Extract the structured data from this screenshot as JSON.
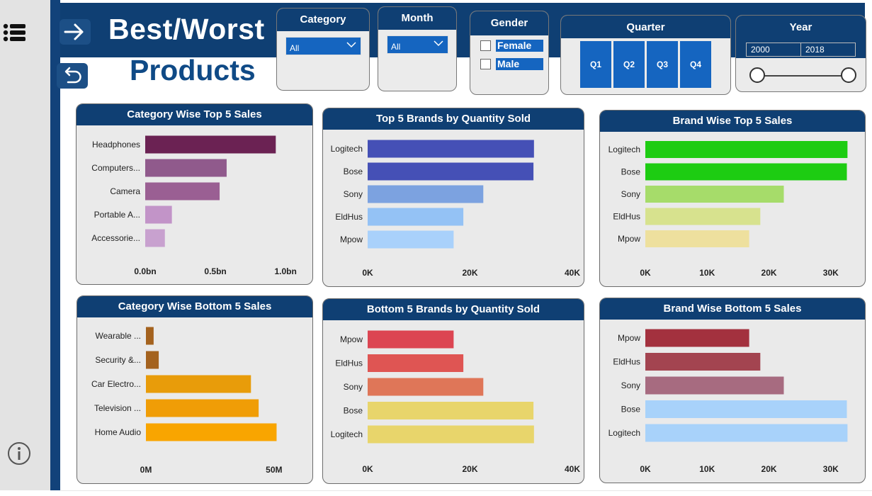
{
  "title": {
    "line1": "Best/Worst",
    "line2": "Products"
  },
  "slicers": {
    "category": {
      "label": "Category",
      "value": "All"
    },
    "month": {
      "label": "Month",
      "value": "All"
    },
    "gender": {
      "label": "Gender",
      "options": [
        "Female",
        "Male"
      ]
    },
    "quarter": {
      "label": "Quarter",
      "options": [
        "Q1",
        "Q2",
        "Q3",
        "Q4"
      ]
    },
    "year": {
      "label": "Year",
      "from": "2000",
      "to": "2018"
    }
  },
  "colors": {
    "header": "#0f3f73",
    "accent": "#1565c0"
  },
  "icons": {
    "menu": "menu-icon",
    "forward": "arrow-right-icon",
    "back": "back-arrow-icon",
    "info": "info-icon"
  },
  "chart_data": [
    {
      "type": "bar",
      "title": "Category Wise Top 5 Sales",
      "categories": [
        "Headphones",
        "Computers...",
        "Camera",
        "Portable A...",
        "Accessorie..."
      ],
      "values": [
        0.93,
        0.58,
        0.53,
        0.19,
        0.14
      ],
      "colors": [
        "#6b2253",
        "#905a8c",
        "#9a5f93",
        "#c294c8",
        "#c8a1cf"
      ],
      "xlim": [
        0,
        1.1
      ],
      "ticks": [
        {
          "v": 0,
          "label": "0.0bn"
        },
        {
          "v": 0.5,
          "label": "0.5bn"
        },
        {
          "v": 1.0,
          "label": "1.0bn"
        }
      ]
    },
    {
      "type": "bar",
      "title": "Top 5 Brands by Quantity Sold",
      "categories": [
        "Logitech",
        "Bose",
        "Sony",
        "EldHus",
        "Mpow"
      ],
      "values": [
        32500,
        32400,
        22600,
        18700,
        16800
      ],
      "colors": [
        "#4550b6",
        "#4550b6",
        "#7ca2e0",
        "#94c2f5",
        "#a9d1fb"
      ],
      "xlim": [
        0,
        40000
      ],
      "ticks": [
        {
          "v": 0,
          "label": "0K"
        },
        {
          "v": 20000,
          "label": "20K"
        },
        {
          "v": 40000,
          "label": "40K"
        }
      ]
    },
    {
      "type": "bar",
      "title": "Brand Wise Top 5 Sales",
      "categories": [
        "Logitech",
        "Bose",
        "Sony",
        "EldHus",
        "Mpow"
      ],
      "values": [
        32700,
        32600,
        22400,
        18600,
        16800
      ],
      "colors": [
        "#1dcc12",
        "#1dcc12",
        "#a6dc6a",
        "#d7e28e",
        "#eee09e"
      ],
      "xlim": [
        0,
        33000
      ],
      "ticks": [
        {
          "v": 0,
          "label": "0K"
        },
        {
          "v": 10000,
          "label": "10K"
        },
        {
          "v": 20000,
          "label": "20K"
        },
        {
          "v": 30000,
          "label": "30K"
        }
      ]
    },
    {
      "type": "bar",
      "title": "Category Wise Bottom 5 Sales",
      "categories": [
        "Wearable ...",
        "Security &...",
        "Car Electro...",
        "Television ...",
        "Home Audio"
      ],
      "values": [
        3,
        5,
        41,
        44,
        51
      ],
      "colors": [
        "#a4621e",
        "#a4621e",
        "#e89c0a",
        "#f09d06",
        "#f9a500"
      ],
      "xlim": [
        0,
        60
      ],
      "ticks": [
        {
          "v": 0,
          "label": "0M"
        },
        {
          "v": 50,
          "label": "50M"
        }
      ]
    },
    {
      "type": "bar",
      "title": "Bottom 5 Brands by Quantity Sold",
      "categories": [
        "Mpow",
        "EldHus",
        "Sony",
        "Bose",
        "Logitech"
      ],
      "values": [
        16800,
        18700,
        22600,
        32400,
        32500
      ],
      "colors": [
        "#dc4552",
        "#df5553",
        "#df7658",
        "#e8d56b",
        "#e8d56b"
      ],
      "xlim": [
        0,
        40000
      ],
      "ticks": [
        {
          "v": 0,
          "label": "0K"
        },
        {
          "v": 20000,
          "label": "20K"
        },
        {
          "v": 40000,
          "label": "40K"
        }
      ]
    },
    {
      "type": "bar",
      "title": "Brand Wise Bottom 5 Sales",
      "categories": [
        "Mpow",
        "EldHus",
        "Sony",
        "Bose",
        "Logitech"
      ],
      "values": [
        16800,
        18600,
        22400,
        32600,
        32700
      ],
      "colors": [
        "#a3313e",
        "#a34450",
        "#a76b80",
        "#a8d2fa",
        "#a8d2fa"
      ],
      "xlim": [
        0,
        33000
      ],
      "ticks": [
        {
          "v": 0,
          "label": "0K"
        },
        {
          "v": 10000,
          "label": "10K"
        },
        {
          "v": 20000,
          "label": "20K"
        },
        {
          "v": 30000,
          "label": "30K"
        }
      ]
    }
  ]
}
